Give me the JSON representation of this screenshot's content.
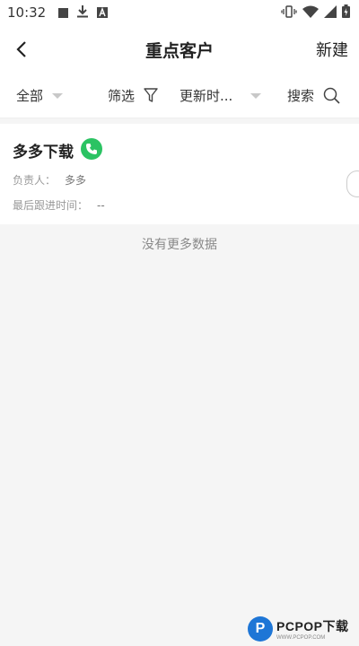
{
  "status_bar": {
    "time": "10:32",
    "left_icons": [
      "stop-icon",
      "download-icon",
      "a-square-icon"
    ],
    "right_icons": [
      "vibrate-icon",
      "wifi-icon",
      "signal-icon",
      "battery-icon"
    ]
  },
  "header": {
    "title": "重点客户",
    "new_label": "新建"
  },
  "filters": {
    "all_label": "全部",
    "filter_label": "筛选",
    "sort_label": "更新时...",
    "search_label": "搜索"
  },
  "customers": [
    {
      "name": "多多下载",
      "owner_label": "负责人：",
      "owner": "多多",
      "last_follow_label": "最后跟进时间：",
      "last_follow": "--"
    }
  ],
  "list_end_text": "没有更多数据",
  "watermark": {
    "letter": "P",
    "main": "PCPOP下载",
    "sub": "WWW.PCPOP.COM"
  },
  "colors": {
    "phone_green": "#2bc363",
    "watermark_blue": "#1e76d6"
  }
}
